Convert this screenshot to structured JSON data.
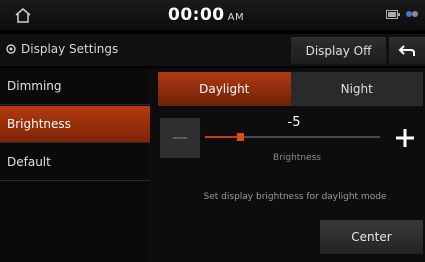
{
  "status_bar": {
    "time": "00:00",
    "ampm": "AM",
    "icons": [
      "home-icon",
      "battery-icon",
      "network-icon"
    ]
  },
  "header": {
    "title": "Display Settings",
    "title_icon": "gear-icon",
    "display_off_label": "Display Off",
    "back_icon": "back-arrow-icon"
  },
  "sidebar": {
    "items": [
      {
        "label": "Dimming",
        "active": false
      },
      {
        "label": "Brightness",
        "active": true
      },
      {
        "label": "Default",
        "active": false
      }
    ]
  },
  "main": {
    "tabs": [
      {
        "label": "Daylight",
        "active": true
      },
      {
        "label": "Night",
        "active": false
      }
    ],
    "slider": {
      "value": "-5",
      "label": "Brightness",
      "level_fraction": 0.2
    },
    "hint": "Set display brightness for daylight mode",
    "center_label": "Center"
  },
  "colors": {
    "accent": "#b53a10",
    "background": "#000000"
  }
}
